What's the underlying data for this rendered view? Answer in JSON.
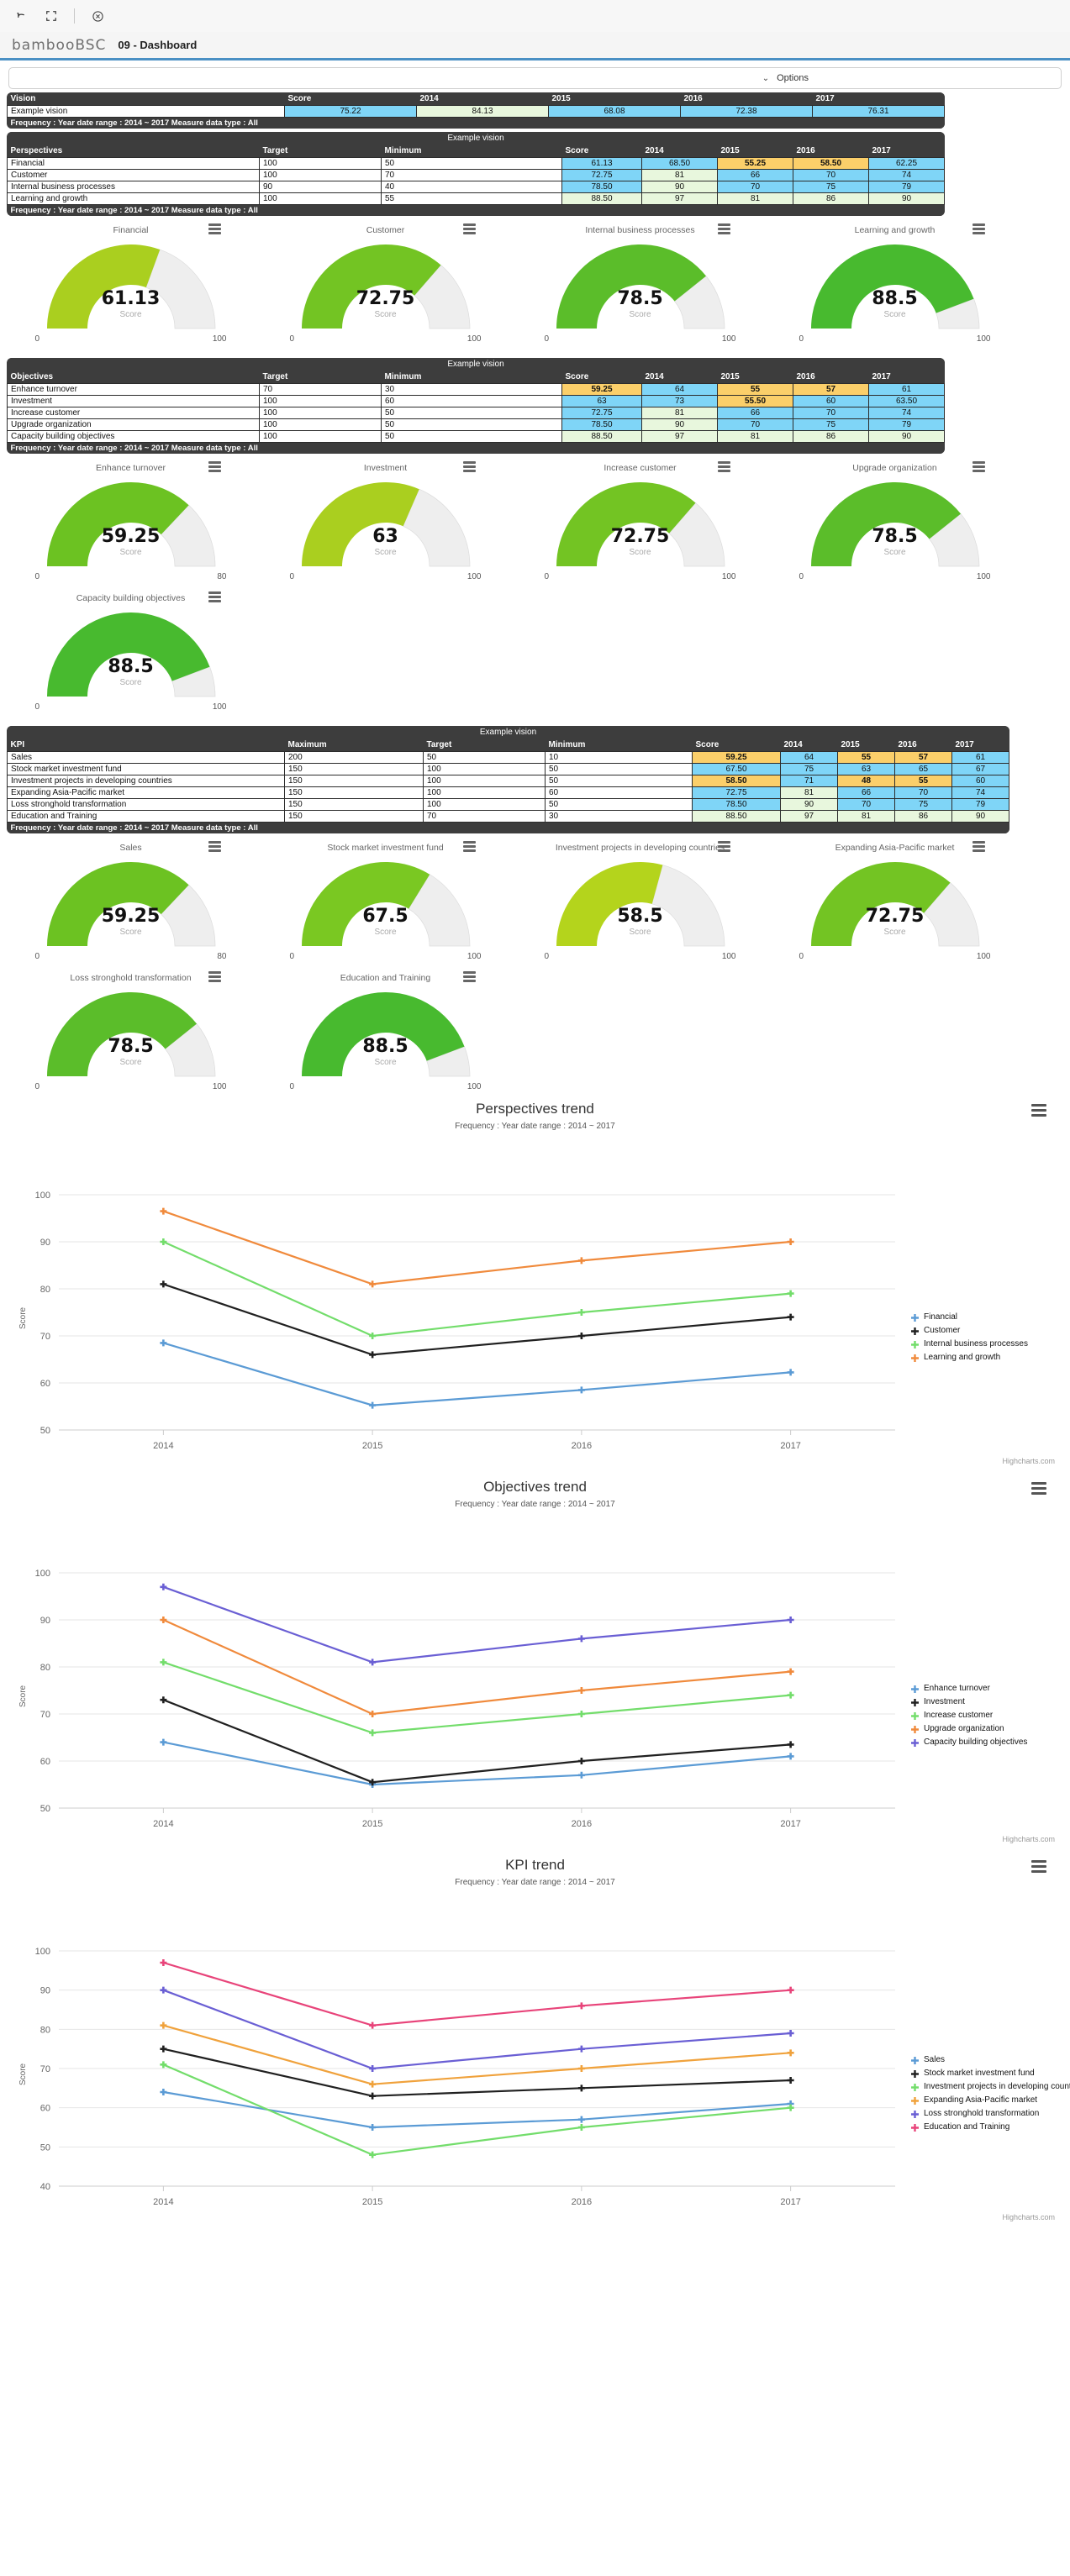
{
  "chrome": {
    "back_icon": "back-arrow-icon",
    "fullscreen_icon": "fullscreen-icon",
    "close_icon": "close-circle-icon"
  },
  "header": {
    "brand": "bambooBSC",
    "title": "09 - Dashboard"
  },
  "options": {
    "label": "Options",
    "caret": "⌄"
  },
  "frequency_note": "Frequency : Year  date range : 2014 ~ 2017  Measure data type : All",
  "vision_table": {
    "columns": [
      "Vision",
      "Score",
      "2014",
      "2015",
      "2016",
      "2017"
    ],
    "rows": [
      {
        "name": "Example vision",
        "cells": [
          {
            "v": "75.22",
            "c": "c-blue"
          },
          {
            "v": "84.13",
            "c": "c-green"
          },
          {
            "v": "68.08",
            "c": "c-blue"
          },
          {
            "v": "72.38",
            "c": "c-blue"
          },
          {
            "v": "76.31",
            "c": "c-blue"
          }
        ]
      }
    ]
  },
  "perspectives_table": {
    "caption": "Example vision",
    "columns": [
      "Perspectives",
      "Target",
      "Minimum",
      "Score",
      "2014",
      "2015",
      "2016",
      "2017"
    ],
    "rows": [
      {
        "name": "Financial",
        "target": "100",
        "minimum": "50",
        "cells": [
          {
            "v": "61.13",
            "c": "c-blue"
          },
          {
            "v": "68.50",
            "c": "c-blue"
          },
          {
            "v": "55.25",
            "c": "c-gold"
          },
          {
            "v": "58.50",
            "c": "c-gold"
          },
          {
            "v": "62.25",
            "c": "c-blue"
          }
        ]
      },
      {
        "name": "Customer",
        "target": "100",
        "minimum": "70",
        "cells": [
          {
            "v": "72.75",
            "c": "c-blue"
          },
          {
            "v": "81",
            "c": "c-green"
          },
          {
            "v": "66",
            "c": "c-blue"
          },
          {
            "v": "70",
            "c": "c-blue"
          },
          {
            "v": "74",
            "c": "c-blue"
          }
        ]
      },
      {
        "name": "Internal business processes",
        "target": "90",
        "minimum": "40",
        "cells": [
          {
            "v": "78.50",
            "c": "c-blue"
          },
          {
            "v": "90",
            "c": "c-green"
          },
          {
            "v": "70",
            "c": "c-blue"
          },
          {
            "v": "75",
            "c": "c-blue"
          },
          {
            "v": "79",
            "c": "c-blue"
          }
        ]
      },
      {
        "name": "Learning and growth",
        "target": "100",
        "minimum": "55",
        "cells": [
          {
            "v": "88.50",
            "c": "c-green"
          },
          {
            "v": "97",
            "c": "c-green"
          },
          {
            "v": "81",
            "c": "c-green"
          },
          {
            "v": "86",
            "c": "c-green"
          },
          {
            "v": "90",
            "c": "c-green"
          }
        ]
      }
    ]
  },
  "objectives_table": {
    "caption": "Example vision",
    "columns": [
      "Objectives",
      "Target",
      "Minimum",
      "Score",
      "2014",
      "2015",
      "2016",
      "2017"
    ],
    "rows": [
      {
        "name": "Enhance turnover",
        "target": "70",
        "minimum": "30",
        "cells": [
          {
            "v": "59.25",
            "c": "c-gold"
          },
          {
            "v": "64",
            "c": "c-blue"
          },
          {
            "v": "55",
            "c": "c-gold"
          },
          {
            "v": "57",
            "c": "c-gold"
          },
          {
            "v": "61",
            "c": "c-blue"
          }
        ]
      },
      {
        "name": "Investment",
        "target": "100",
        "minimum": "60",
        "cells": [
          {
            "v": "63",
            "c": "c-blue"
          },
          {
            "v": "73",
            "c": "c-blue"
          },
          {
            "v": "55.50",
            "c": "c-gold"
          },
          {
            "v": "60",
            "c": "c-blue"
          },
          {
            "v": "63.50",
            "c": "c-blue"
          }
        ]
      },
      {
        "name": "Increase customer",
        "target": "100",
        "minimum": "50",
        "cells": [
          {
            "v": "72.75",
            "c": "c-blue"
          },
          {
            "v": "81",
            "c": "c-green"
          },
          {
            "v": "66",
            "c": "c-blue"
          },
          {
            "v": "70",
            "c": "c-blue"
          },
          {
            "v": "74",
            "c": "c-blue"
          }
        ]
      },
      {
        "name": "Upgrade organization",
        "target": "100",
        "minimum": "50",
        "cells": [
          {
            "v": "78.50",
            "c": "c-blue"
          },
          {
            "v": "90",
            "c": "c-green"
          },
          {
            "v": "70",
            "c": "c-blue"
          },
          {
            "v": "75",
            "c": "c-blue"
          },
          {
            "v": "79",
            "c": "c-blue"
          }
        ]
      },
      {
        "name": "Capacity building objectives",
        "target": "100",
        "minimum": "50",
        "cells": [
          {
            "v": "88.50",
            "c": "c-green"
          },
          {
            "v": "97",
            "c": "c-green"
          },
          {
            "v": "81",
            "c": "c-green"
          },
          {
            "v": "86",
            "c": "c-green"
          },
          {
            "v": "90",
            "c": "c-green"
          }
        ]
      }
    ]
  },
  "kpi_table": {
    "caption": "Example vision",
    "columns": [
      "KPI",
      "Maximum",
      "Target",
      "Minimum",
      "Score",
      "2014",
      "2015",
      "2016",
      "2017"
    ],
    "rows": [
      {
        "name": "Sales",
        "maximum": "200",
        "target": "50",
        "minimum": "10",
        "cells": [
          {
            "v": "59.25",
            "c": "c-gold"
          },
          {
            "v": "64",
            "c": "c-blue"
          },
          {
            "v": "55",
            "c": "c-gold"
          },
          {
            "v": "57",
            "c": "c-gold"
          },
          {
            "v": "61",
            "c": "c-blue"
          }
        ]
      },
      {
        "name": "Stock market investment fund",
        "maximum": "150",
        "target": "100",
        "minimum": "50",
        "cells": [
          {
            "v": "67.50",
            "c": "c-blue"
          },
          {
            "v": "75",
            "c": "c-blue"
          },
          {
            "v": "63",
            "c": "c-blue"
          },
          {
            "v": "65",
            "c": "c-blue"
          },
          {
            "v": "67",
            "c": "c-blue"
          }
        ]
      },
      {
        "name": "Investment projects in developing countries",
        "maximum": "150",
        "target": "100",
        "minimum": "50",
        "cells": [
          {
            "v": "58.50",
            "c": "c-gold"
          },
          {
            "v": "71",
            "c": "c-blue"
          },
          {
            "v": "48",
            "c": "c-gold"
          },
          {
            "v": "55",
            "c": "c-gold"
          },
          {
            "v": "60",
            "c": "c-blue"
          }
        ]
      },
      {
        "name": "Expanding Asia-Pacific market",
        "maximum": "150",
        "target": "100",
        "minimum": "60",
        "cells": [
          {
            "v": "72.75",
            "c": "c-blue"
          },
          {
            "v": "81",
            "c": "c-green"
          },
          {
            "v": "66",
            "c": "c-blue"
          },
          {
            "v": "70",
            "c": "c-blue"
          },
          {
            "v": "74",
            "c": "c-blue"
          }
        ]
      },
      {
        "name": "Loss stronghold transformation",
        "maximum": "150",
        "target": "100",
        "minimum": "50",
        "cells": [
          {
            "v": "78.50",
            "c": "c-blue"
          },
          {
            "v": "90",
            "c": "c-green"
          },
          {
            "v": "70",
            "c": "c-blue"
          },
          {
            "v": "75",
            "c": "c-blue"
          },
          {
            "v": "79",
            "c": "c-blue"
          }
        ]
      },
      {
        "name": "Education and Training",
        "maximum": "150",
        "target": "70",
        "minimum": "30",
        "cells": [
          {
            "v": "88.50",
            "c": "c-green"
          },
          {
            "v": "97",
            "c": "c-green"
          },
          {
            "v": "81",
            "c": "c-green"
          },
          {
            "v": "86",
            "c": "c-green"
          },
          {
            "v": "90",
            "c": "c-green"
          }
        ]
      }
    ]
  },
  "gauge_sub_label": "Score",
  "perspective_gauges": [
    {
      "title": "Financial",
      "value": "61.13",
      "num": 61.13,
      "min": "0",
      "max": "100",
      "maxn": 100,
      "color": "#aacf1f"
    },
    {
      "title": "Customer",
      "value": "72.75",
      "num": 72.75,
      "min": "0",
      "max": "100",
      "maxn": 100,
      "color": "#73c423"
    },
    {
      "title": "Internal business processes",
      "value": "78.5",
      "num": 78.5,
      "min": "0",
      "max": "100",
      "maxn": 100,
      "color": "#5bbd2a"
    },
    {
      "title": "Learning and growth",
      "value": "88.5",
      "num": 88.5,
      "min": "0",
      "max": "100",
      "maxn": 100,
      "color": "#48ba2f"
    }
  ],
  "objective_gauges": [
    {
      "title": "Enhance turnover",
      "value": "59.25",
      "num": 59.25,
      "min": "0",
      "max": "80",
      "maxn": 80,
      "color": "#6cc222"
    },
    {
      "title": "Investment",
      "value": "63",
      "num": 63,
      "min": "0",
      "max": "100",
      "maxn": 100,
      "color": "#aacf1f"
    },
    {
      "title": "Increase customer",
      "value": "72.75",
      "num": 72.75,
      "min": "0",
      "max": "100",
      "maxn": 100,
      "color": "#73c423"
    },
    {
      "title": "Upgrade organization",
      "value": "78.5",
      "num": 78.5,
      "min": "0",
      "max": "100",
      "maxn": 100,
      "color": "#5bbd2a"
    },
    {
      "title": "Capacity building objectives",
      "value": "88.5",
      "num": 88.5,
      "min": "0",
      "max": "100",
      "maxn": 100,
      "color": "#48ba2f"
    }
  ],
  "kpi_gauges": [
    {
      "title": "Sales",
      "value": "59.25",
      "num": 59.25,
      "min": "0",
      "max": "80",
      "maxn": 80,
      "color": "#6cc222"
    },
    {
      "title": "Stock market investment fund",
      "value": "67.5",
      "num": 67.5,
      "min": "0",
      "max": "100",
      "maxn": 100,
      "color": "#7ac822"
    },
    {
      "title": "Investment projects in developing countries",
      "value": "58.5",
      "num": 58.5,
      "min": "0",
      "max": "100",
      "maxn": 100,
      "color": "#b4d41c"
    },
    {
      "title": "Expanding Asia-Pacific market",
      "value": "72.75",
      "num": 72.75,
      "min": "0",
      "max": "100",
      "maxn": 100,
      "color": "#73c423"
    },
    {
      "title": "Loss stronghold transformation",
      "value": "78.5",
      "num": 78.5,
      "min": "0",
      "max": "100",
      "maxn": 100,
      "color": "#5bbd2a"
    },
    {
      "title": "Education and Training",
      "value": "88.5",
      "num": 88.5,
      "min": "0",
      "max": "100",
      "maxn": 100,
      "color": "#48ba2f"
    }
  ],
  "chart_credit": "Highcharts.com",
  "chart_data": [
    {
      "type": "line",
      "title": "Perspectives trend",
      "subtitle": "Frequency : Year date range : 2014 ~ 2017",
      "xlabel": "",
      "ylabel": "Score",
      "categories": [
        "2014",
        "2015",
        "2016",
        "2017"
      ],
      "ylim": [
        50,
        100
      ],
      "yticks": [
        50,
        60,
        70,
        80,
        90,
        100
      ],
      "grid": true,
      "legend_position": "right",
      "series": [
        {
          "name": "Financial",
          "color": "#5b9bd5",
          "marker": "plus",
          "values": [
            68.5,
            55.25,
            58.5,
            62.25
          ]
        },
        {
          "name": "Customer",
          "color": "#202020",
          "marker": "plus",
          "values": [
            81,
            66,
            70,
            74
          ]
        },
        {
          "name": "Internal business processes",
          "color": "#73dd6b",
          "marker": "plus",
          "values": [
            90,
            70,
            75,
            79
          ]
        },
        {
          "name": "Learning and growth",
          "color": "#f08a3c",
          "marker": "plus",
          "values": [
            96.5,
            81,
            86,
            90
          ]
        }
      ]
    },
    {
      "type": "line",
      "title": "Objectives trend",
      "subtitle": "Frequency : Year date range : 2014 ~ 2017",
      "xlabel": "",
      "ylabel": "Score",
      "categories": [
        "2014",
        "2015",
        "2016",
        "2017"
      ],
      "ylim": [
        50,
        100
      ],
      "yticks": [
        50,
        60,
        70,
        80,
        90,
        100
      ],
      "grid": true,
      "legend_position": "right",
      "series": [
        {
          "name": "Enhance turnover",
          "color": "#5b9bd5",
          "marker": "plus",
          "values": [
            64,
            55,
            57,
            61
          ]
        },
        {
          "name": "Investment",
          "color": "#202020",
          "marker": "plus",
          "values": [
            73,
            55.5,
            60,
            63.5
          ]
        },
        {
          "name": "Increase customer",
          "color": "#73dd6b",
          "marker": "plus",
          "values": [
            81,
            66,
            70,
            74
          ]
        },
        {
          "name": "Upgrade organization",
          "color": "#f08a3c",
          "marker": "plus",
          "values": [
            90,
            70,
            75,
            79
          ]
        },
        {
          "name": "Capacity building objectives",
          "color": "#6a5fd4",
          "marker": "plus",
          "values": [
            97,
            81,
            86,
            90
          ]
        }
      ]
    },
    {
      "type": "line",
      "title": "KPI trend",
      "subtitle": "Frequency : Year date range : 2014 ~ 2017",
      "xlabel": "",
      "ylabel": "Score",
      "categories": [
        "2014",
        "2015",
        "2016",
        "2017"
      ],
      "ylim": [
        40,
        100
      ],
      "yticks": [
        40,
        50,
        60,
        70,
        80,
        90,
        100
      ],
      "grid": true,
      "legend_position": "right",
      "series": [
        {
          "name": "Sales",
          "color": "#5b9bd5",
          "marker": "plus",
          "values": [
            64,
            55,
            57,
            61
          ]
        },
        {
          "name": "Stock market investment fund",
          "color": "#202020",
          "marker": "plus",
          "values": [
            75,
            63,
            65,
            67
          ]
        },
        {
          "name": "Investment projects in developing countries",
          "color": "#73dd6b",
          "marker": "plus",
          "values": [
            71,
            48,
            55,
            60
          ]
        },
        {
          "name": "Expanding Asia-Pacific market",
          "color": "#f0a23c",
          "marker": "plus",
          "values": [
            81,
            66,
            70,
            74
          ]
        },
        {
          "name": "Loss stronghold transformation",
          "color": "#6a5fd4",
          "marker": "plus",
          "values": [
            90,
            70,
            75,
            79
          ]
        },
        {
          "name": "Education and Training",
          "color": "#e8447a",
          "marker": "plus",
          "values": [
            97,
            81,
            86,
            90
          ]
        }
      ]
    }
  ]
}
